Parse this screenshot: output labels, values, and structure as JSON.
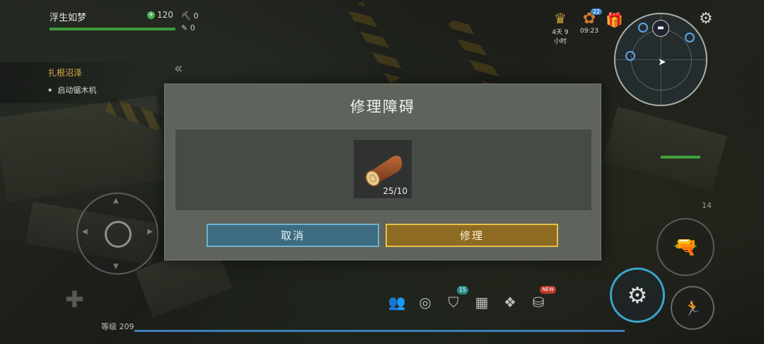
{
  "player": {
    "name": "浮生如梦",
    "hp": "120",
    "hp_fraction": 1.0
  },
  "counters": {
    "first": "0",
    "second": "0"
  },
  "quest": {
    "title": "扎根沼泽",
    "objective": "启动锯木机"
  },
  "top_right": {
    "timer_label": "4天 9小时",
    "event_badge": "22",
    "event_time": "09:23"
  },
  "dialog": {
    "title": "修理障碍",
    "item": {
      "icon": "wood-log-icon",
      "count": "25/10"
    },
    "cancel_label": "取消",
    "repair_label": "修理"
  },
  "hud": {
    "level_label": "等级 209",
    "xp_fraction": 0.99,
    "hotbar_badge": "15",
    "new_badge": "NEW",
    "ammo": "14"
  },
  "colors": {
    "cancel_button": "#3d6b7f",
    "repair_button": "#8e6a22",
    "hp_bar": "#3e9a3a",
    "action_ring": "#3aa6c9"
  }
}
